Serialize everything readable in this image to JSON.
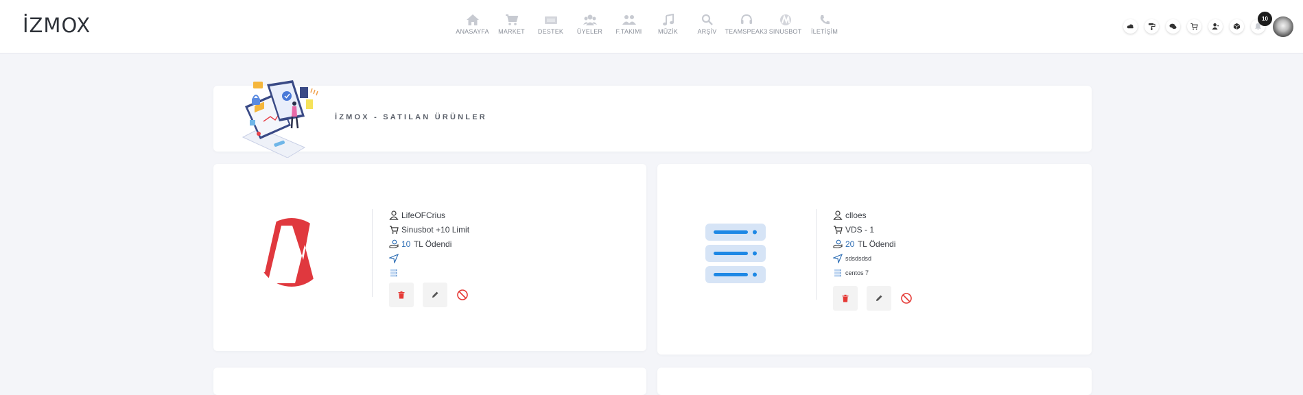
{
  "brand": {
    "logo_text": "İZMOX"
  },
  "nav": {
    "items": [
      {
        "label": "ANASAYFA",
        "icon": "home-icon"
      },
      {
        "label": "MARKET",
        "icon": "cart-icon"
      },
      {
        "label": "DESTEK",
        "icon": "ticket-icon"
      },
      {
        "label": "ÜYELER",
        "icon": "users-icon"
      },
      {
        "label": "F.TAKIMI",
        "icon": "team-icon"
      },
      {
        "label": "MÜZİK",
        "icon": "music-icon"
      },
      {
        "label": "ARŞİV",
        "icon": "search-icon"
      },
      {
        "label": "TEAMSPEAK3",
        "icon": "headset-icon"
      },
      {
        "label": "SINUSBOT",
        "icon": "sinusbot-icon"
      },
      {
        "label": "İLETİŞİM",
        "icon": "phone-icon"
      }
    ]
  },
  "header_actions": {
    "icons": [
      "cloud-icon",
      "paint-roller-icon",
      "chat-icon",
      "cart-icon",
      "user-icon",
      "cube-icon",
      "bell-icon"
    ],
    "notification_count": "10"
  },
  "page": {
    "title": "İZMOX - SATILAN ÜRÜNLER"
  },
  "products": [
    {
      "username": "LifeOFCrius",
      "product": "Sinusbot +10 Limit",
      "price": "10",
      "price_suffix": "TL Ödendi",
      "location": "",
      "os": "",
      "image": "sinusbot-logo"
    },
    {
      "username": "clloes",
      "product": "VDS - 1",
      "price": "20",
      "price_suffix": "TL Ödendi",
      "location": "sdsdsdsd",
      "os": "centos 7",
      "image": "server-illustration"
    }
  ],
  "colors": {
    "accent": "#2f6fb5",
    "danger": "#e53935",
    "sinusbot_red": "#e0383e",
    "server_blue": "#1e88e5",
    "background": "#f4f5f9"
  }
}
